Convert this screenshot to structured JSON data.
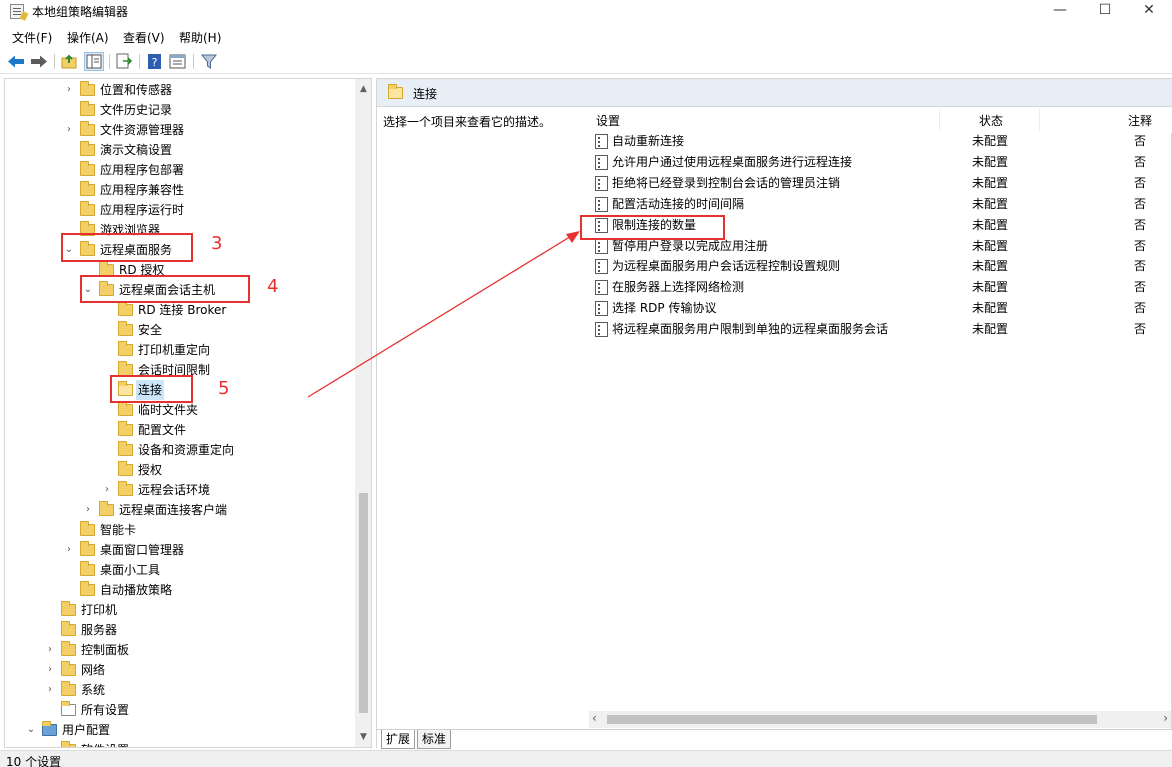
{
  "window": {
    "title": "本地组策略编辑器",
    "minimize_glyph": "—",
    "maximize_glyph": "☐",
    "close_glyph": "✕"
  },
  "menu": [
    "文件(F)",
    "操作(A)",
    "查看(V)",
    "帮助(H)"
  ],
  "toolbar": {
    "icons": [
      "back-arrow-icon",
      "forward-arrow-icon",
      "up-folder-icon",
      "show-hide-tree-icon",
      "export-list-icon",
      "help-icon",
      "properties-icon",
      "filter-icon"
    ],
    "colors": {
      "back": "#1e78c8",
      "forward": "#5c5c5c"
    }
  },
  "tree": {
    "items": [
      {
        "label": "位置和传感器",
        "expander": "›"
      },
      {
        "label": "文件历史记录",
        "expander": ""
      },
      {
        "label": "文件资源管理器",
        "expander": "›"
      },
      {
        "label": "演示文稿设置",
        "expander": ""
      },
      {
        "label": "应用程序包部署",
        "expander": ""
      },
      {
        "label": "应用程序兼容性",
        "expander": ""
      },
      {
        "label": "应用程序运行时",
        "expander": ""
      },
      {
        "label": "游戏浏览器",
        "expander": ""
      },
      {
        "label": "远程桌面服务",
        "expander": "⌄"
      },
      {
        "label": "RD 授权",
        "expander": ""
      },
      {
        "label": "远程桌面会话主机",
        "expander": "⌄"
      },
      {
        "label": "RD 连接 Broker",
        "expander": ""
      },
      {
        "label": "安全",
        "expander": ""
      },
      {
        "label": "打印机重定向",
        "expander": ""
      },
      {
        "label": "会话时间限制",
        "expander": ""
      },
      {
        "label": "连接",
        "expander": ""
      },
      {
        "label": "临时文件夹",
        "expander": ""
      },
      {
        "label": "配置文件",
        "expander": ""
      },
      {
        "label": "设备和资源重定向",
        "expander": ""
      },
      {
        "label": "授权",
        "expander": ""
      },
      {
        "label": "远程会话环境",
        "expander": "›"
      },
      {
        "label": "远程桌面连接客户端",
        "expander": "›"
      },
      {
        "label": "智能卡",
        "expander": ""
      },
      {
        "label": "桌面窗口管理器",
        "expander": "›"
      },
      {
        "label": "桌面小工具",
        "expander": ""
      },
      {
        "label": "自动播放策略",
        "expander": ""
      },
      {
        "label": "打印机",
        "expander": ""
      },
      {
        "label": "服务器",
        "expander": ""
      },
      {
        "label": "控制面板",
        "expander": "›"
      },
      {
        "label": "网络",
        "expander": "›"
      },
      {
        "label": "系统",
        "expander": "›"
      },
      {
        "label": "所有设置",
        "expander": ""
      },
      {
        "label": "用户配置",
        "expander": "⌄"
      },
      {
        "label": "软件设置",
        "expander": "›"
      }
    ],
    "scroll_up": "▲",
    "scroll_down": "▼"
  },
  "annotations": {
    "step3": "3",
    "step4": "4",
    "step5": "5",
    "color": "#e5312f"
  },
  "right": {
    "header_title": "连接",
    "description": "选择一个项目来查看它的描述。",
    "columns": {
      "setting": "设置",
      "state": "状态",
      "note": "注释"
    },
    "settings": [
      {
        "name": "自动重新连接",
        "state": "未配置",
        "note": "否"
      },
      {
        "name": "允许用户通过使用远程桌面服务进行远程连接",
        "state": "未配置",
        "note": "否"
      },
      {
        "name": "拒绝将已经登录到控制台会话的管理员注销",
        "state": "未配置",
        "note": "否"
      },
      {
        "name": "配置活动连接的时间间隔",
        "state": "未配置",
        "note": "否"
      },
      {
        "name": "限制连接的数量",
        "state": "未配置",
        "note": "否"
      },
      {
        "name": "暂停用户登录以完成应用注册",
        "state": "未配置",
        "note": "否"
      },
      {
        "name": "为远程桌面服务用户会话远程控制设置规则",
        "state": "未配置",
        "note": "否"
      },
      {
        "name": "在服务器上选择网络检测",
        "state": "未配置",
        "note": "否"
      },
      {
        "name": "选择 RDP 传输协议",
        "state": "未配置",
        "note": "否"
      },
      {
        "name": "将远程桌面服务用户限制到单独的远程桌面服务会话",
        "state": "未配置",
        "note": "否"
      }
    ],
    "scroll_left": "‹",
    "scroll_right": "›",
    "tabs": [
      "扩展",
      "标准"
    ]
  },
  "status": {
    "text": "10 个设置"
  }
}
